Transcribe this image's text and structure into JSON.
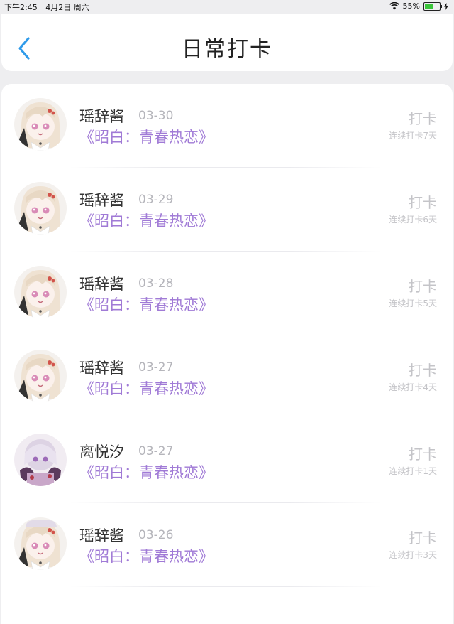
{
  "status": {
    "time": "下午2:45",
    "date": "4月2日 周六",
    "battery": "55%",
    "battery_level": 0.55
  },
  "nav": {
    "title": "日常打卡"
  },
  "colors": {
    "accent": "#2f9bea",
    "book": "#a07ad6",
    "muted": "#c4c4c8"
  },
  "entries": [
    {
      "name": "瑶辞酱",
      "date": "03-30",
      "book": "《昭白：青春热恋》",
      "action": "打卡",
      "streak": "连续打卡7天",
      "avatar": "anime-girl-blonde"
    },
    {
      "name": "瑶辞酱",
      "date": "03-29",
      "book": "《昭白：青春热恋》",
      "action": "打卡",
      "streak": "连续打卡6天",
      "avatar": "anime-girl-blonde"
    },
    {
      "name": "瑶辞酱",
      "date": "03-28",
      "book": "《昭白：青春热恋》",
      "action": "打卡",
      "streak": "连续打卡5天",
      "avatar": "anime-girl-blonde"
    },
    {
      "name": "瑶辞酱",
      "date": "03-27",
      "book": "《昭白：青春热恋》",
      "action": "打卡",
      "streak": "连续打卡4天",
      "avatar": "anime-girl-blonde"
    },
    {
      "name": "离悦汐",
      "date": "03-27",
      "book": "《昭白：青春热恋》",
      "action": "打卡",
      "streak": "连续打卡1天",
      "avatar": "anime-girl-purple"
    },
    {
      "name": "瑶辞酱",
      "date": "03-26",
      "book": "《昭白：青春热恋》",
      "action": "打卡",
      "streak": "连续打卡3天",
      "avatar": "anime-girl-blonde"
    }
  ]
}
